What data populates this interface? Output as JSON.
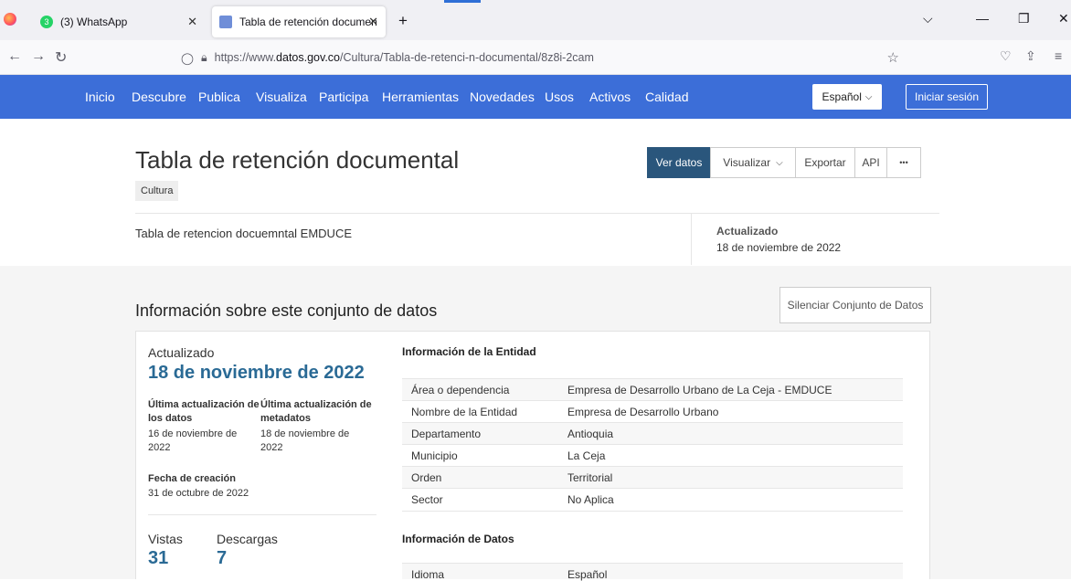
{
  "browser": {
    "tabs": [
      {
        "title": "(3) WhatsApp",
        "badge": "3"
      },
      {
        "title": "Tabla de retención documental"
      }
    ],
    "new_tab": "+",
    "url_prefix": "https://www.",
    "url_domain": "datos.gov.co",
    "url_path": "/Cultura/Tabla-de-retenci-n-documental/8z8i-2cam"
  },
  "sitenav": {
    "items": [
      "Inicio",
      "Descubre",
      "Publica",
      "Visualiza",
      "Participa",
      "Herramientas",
      "Novedades",
      "Usos",
      "Activos",
      "Calidad"
    ],
    "language": "Español",
    "login": "Iniciar sesión"
  },
  "header": {
    "title": "Tabla de retención documental",
    "category": "Cultura",
    "actions": {
      "view": "Ver datos",
      "visualize": "Visualizar",
      "export": "Exportar",
      "api": "API",
      "more": "•••"
    },
    "description": "Tabla de retencion docuemntal EMDUCE",
    "updated_label": "Actualizado",
    "updated_value": "18 de noviembre de 2022"
  },
  "info": {
    "title": "Información sobre este conjunto de datos",
    "silence_button": "Silenciar Conjunto de Datos",
    "updated_label": "Actualizado",
    "updated_big": "18 de noviembre de 2022",
    "data_update_label_1": "Última actualización de",
    "data_update_label_2": "los datos",
    "data_update_value_1": "16 de noviembre de",
    "data_update_value_2": "2022",
    "meta_update_label_1": "Última actualización de",
    "meta_update_label_2": "metadatos",
    "meta_update_value_1": "18 de noviembre de",
    "meta_update_value_2": "2022",
    "creation_label": "Fecha de creación",
    "creation_value": "31 de octubre de 2022",
    "views_label": "Vistas",
    "views_value": "31",
    "downloads_label": "Descargas",
    "downloads_value": "7"
  },
  "entity": {
    "heading": "Información de la Entidad",
    "rows": [
      {
        "k": "Área o dependencia",
        "v": "Empresa de Desarrollo Urbano de La Ceja - EMDUCE"
      },
      {
        "k": "Nombre de la Entidad",
        "v": "Empresa de Desarrollo Urbano"
      },
      {
        "k": "Departamento",
        "v": "Antioquia"
      },
      {
        "k": "Municipio",
        "v": "La Ceja"
      },
      {
        "k": "Orden",
        "v": "Territorial"
      },
      {
        "k": "Sector",
        "v": "No Aplica"
      }
    ]
  },
  "datainfo": {
    "heading": "Información de Datos",
    "rows": [
      {
        "k": "Idioma",
        "v": "Español"
      }
    ]
  }
}
